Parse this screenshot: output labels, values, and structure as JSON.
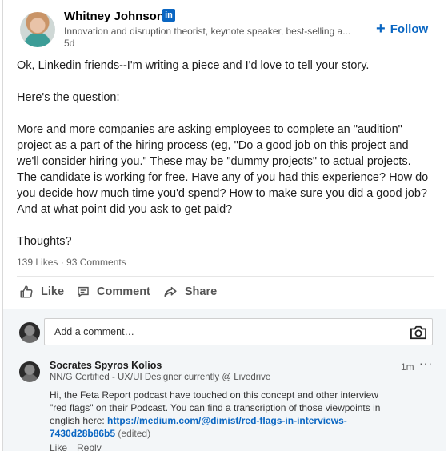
{
  "post": {
    "author_name": "Whitney Johnson",
    "linkedin_badge": "in",
    "author_headline": "Innovation and disruption theorist, keynote speaker, best-selling a...",
    "age": "5d",
    "follow_label": "Follow",
    "body": [
      "Ok, Linkedin friends--I'm writing a piece and I'd love to tell your story.",
      "Here's the question:",
      "More and more companies are asking employees to complete an \"audition\" project as a part of the hiring process (eg, \"Do a good job on this project and we'll consider hiring you.\" These may be \"dummy projects\" to actual projects. The candidate is working for free. Have any of you had this experience? How do you decide how much time you'd spend? How to make sure you did a good job? And at what point did you ask to get paid?",
      "Thoughts?"
    ],
    "counts": "139 Likes · 93 Comments",
    "actions": {
      "like": "Like",
      "comment": "Comment",
      "share": "Share"
    }
  },
  "comment_box": {
    "placeholder": "Add a comment…"
  },
  "comment": {
    "author": "Socrates Spyros Kolios",
    "headline": "NN/G Certified - UX/UI Designer currently @ Livedrive",
    "time": "1m",
    "more": "···",
    "text": "Hi, the Feta Report podcast have touched on this concept and other interview \"red flags\" on their Podcast. You can find a transcription of those viewpoints in english here: ",
    "link": "https://medium.com/@dimist/red-flags-in-interviews-7430d28b86b5",
    "edited": "(edited)",
    "like": "Like",
    "reply": "Reply"
  },
  "colors": {
    "brand": "#0a66c2",
    "comments_bg": "#f3f6f8"
  }
}
